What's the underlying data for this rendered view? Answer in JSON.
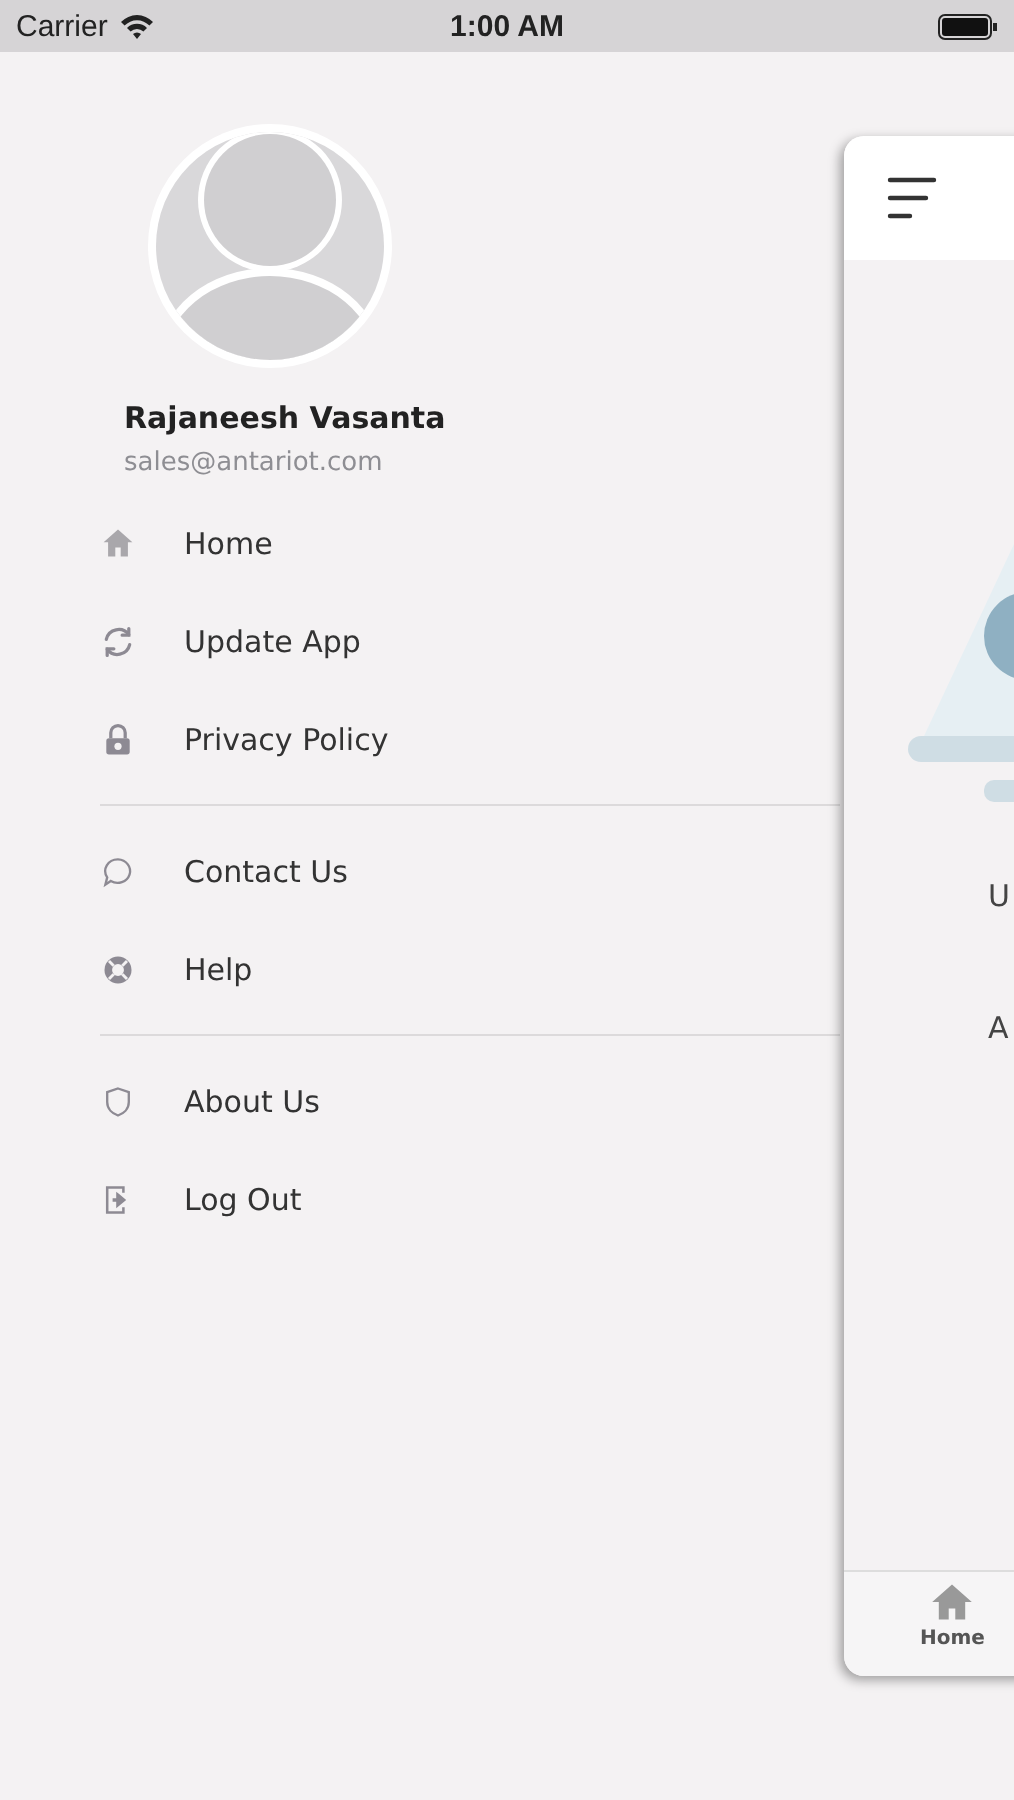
{
  "status_bar": {
    "carrier": "Carrier",
    "time": "1:00 AM"
  },
  "profile": {
    "name": "Rajaneesh Vasanta",
    "email": "sales@antariot.com"
  },
  "menu": [
    [
      {
        "kind": "home",
        "label": "Home"
      },
      {
        "kind": "refresh",
        "label": "Update App"
      },
      {
        "kind": "lock",
        "label": "Privacy Policy"
      }
    ],
    [
      {
        "kind": "chat",
        "label": "Contact Us"
      },
      {
        "kind": "help",
        "label": "Help"
      }
    ],
    [
      {
        "kind": "shield",
        "label": "About Us"
      },
      {
        "kind": "logout",
        "label": "Log Out"
      }
    ]
  ],
  "main_screen": {
    "texts": [
      "U",
      "A"
    ],
    "tab_bar": [
      {
        "label": "Home"
      }
    ]
  }
}
